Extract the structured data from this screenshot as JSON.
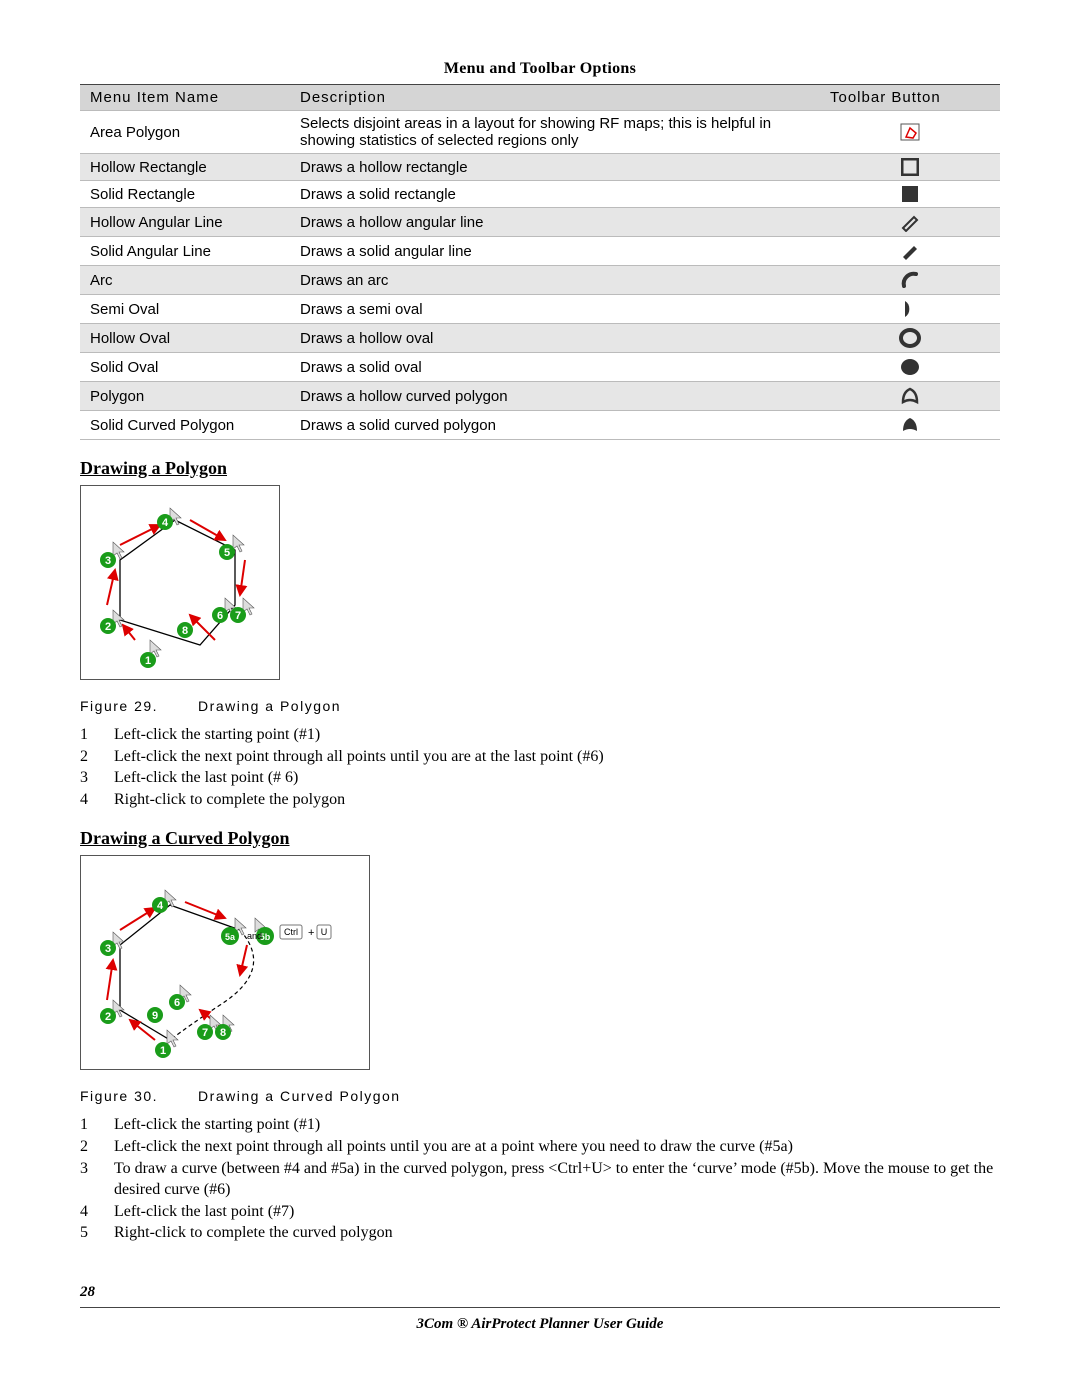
{
  "header": "Menu and Toolbar Options",
  "table": {
    "headers": [
      "Menu Item Name",
      "Description",
      "Toolbar Button"
    ],
    "rows": [
      {
        "name": "Area Polygon",
        "desc": "Selects disjoint areas in a layout for showing RF maps; this is helpful in showing statistics of selected regions only",
        "icon": "area-polygon-icon"
      },
      {
        "name": "Hollow Rectangle",
        "desc": "Draws a hollow rectangle",
        "icon": "hollow-rectangle-icon"
      },
      {
        "name": "Solid Rectangle",
        "desc": "Draws a solid rectangle",
        "icon": "solid-rectangle-icon"
      },
      {
        "name": "Hollow Angular Line",
        "desc": "Draws a hollow angular line",
        "icon": "hollow-angular-line-icon"
      },
      {
        "name": "Solid Angular Line",
        "desc": "Draws a solid angular line",
        "icon": "solid-angular-line-icon"
      },
      {
        "name": "Arc",
        "desc": "Draws an arc",
        "icon": "arc-icon"
      },
      {
        "name": "Semi Oval",
        "desc": "Draws a semi oval",
        "icon": "semi-oval-icon"
      },
      {
        "name": "Hollow Oval",
        "desc": "Draws a hollow oval",
        "icon": "hollow-oval-icon"
      },
      {
        "name": "Solid Oval",
        "desc": "Draws a solid oval",
        "icon": "solid-oval-icon"
      },
      {
        "name": "Polygon",
        "desc": "Draws a hollow curved polygon",
        "icon": "polygon-icon"
      },
      {
        "name": "Solid Curved Polygon",
        "desc": "Draws a solid curved polygon",
        "icon": "solid-curved-polygon-icon"
      }
    ]
  },
  "section1": {
    "title": "Drawing a Polygon",
    "fig_num": "Figure 29.",
    "fig_caption": "Drawing a Polygon",
    "steps": [
      "Left-click the starting point (#1)",
      "Left-click the next point through all points until you are at the last point (#6)",
      "Left-click the last point (# 6)",
      "Right-click to complete the polygon"
    ],
    "diagram_badges": [
      "1",
      "2",
      "3",
      "4",
      "5",
      "6",
      "7",
      "8"
    ]
  },
  "section2": {
    "title": "Drawing a Curved Polygon",
    "fig_num": "Figure 30.",
    "fig_caption": "Drawing a Curved Polygon",
    "key_hint": {
      "ctrl": "Ctrl",
      "plus": "+",
      "u": "U",
      "and": "and"
    },
    "steps": [
      "Left-click the starting point (#1)",
      "Left-click the next point through all points until you are at a point where you need to draw the curve (#5a)",
      "To draw a curve (between #4 and #5a) in the curved polygon, press <Ctrl+U> to enter the ‘curve’ mode (#5b). Move the mouse to get the desired curve (#6)",
      "Left-click the last point (#7)",
      "Right-click to complete the curved polygon"
    ],
    "diagram_badges": [
      "1",
      "2",
      "3",
      "4",
      "5a",
      "5b",
      "6",
      "7",
      "8",
      "9"
    ]
  },
  "footer": {
    "page_number": "28",
    "doc_title": "3Com ® AirProtect Planner User Guide"
  }
}
